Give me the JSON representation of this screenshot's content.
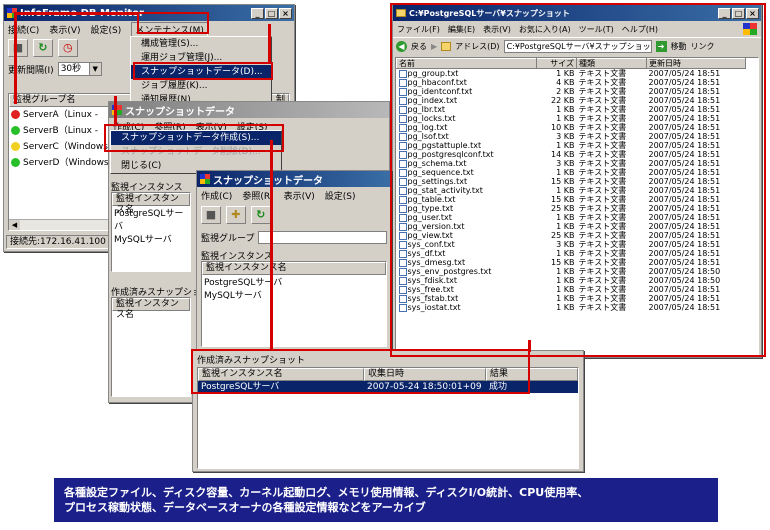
{
  "monitor": {
    "title": "InfoFrame DB Monitor",
    "menu": [
      "接続(C)",
      "表示(V)",
      "設定(S)",
      "メンテナンス(M)"
    ],
    "interval_label": "更新間隔(I)",
    "interval_value": "30秒",
    "group_header": "監視グループ名",
    "col_right": "制",
    "servers": [
      {
        "label": "ServerA（Linux -",
        "status": "error"
      },
      {
        "label": "ServerB（Linux -",
        "status": "ok"
      },
      {
        "label": "ServerC（Windows",
        "status": "warn"
      },
      {
        "label": "ServerD（Windows",
        "status": "ok"
      }
    ],
    "status_bar": "接続先:172.16.41.100",
    "maintenance_menu": [
      "構成管理(S)...",
      "運用ジョブ管理(J)...",
      "スナップショットデータ(D)...",
      "ジョブ履歴(K)...",
      "通知履歴(N)..."
    ]
  },
  "snap1": {
    "title": "スナップショットデータ",
    "menu": [
      "作成(C)",
      "参照(R)",
      "表示(V)",
      "設定(S)"
    ],
    "create_menu": [
      "スナップショットデータ作成(S)...",
      "スナップショットデータ削除(D)...",
      "閉じる(C)"
    ],
    "instance_section": "監視インスタンス",
    "instance_header": "監視インスタンス名",
    "instances": [
      "PostgreSQLサーバ",
      "MySQLサーバ"
    ],
    "created_section": "作成済みスナップショット",
    "created_header": "監視インスタンス名"
  },
  "snap2": {
    "title": "スナップショットデータ",
    "menu": [
      "作成(C)",
      "参照(R)",
      "表示(V)",
      "設定(S)"
    ],
    "group_label": "監視グループ",
    "instance_section": "監視インスタンス",
    "instance_header": "監視インスタンス名",
    "instances": [
      "PostgreSQLサーバ",
      "MySQLサーバ"
    ]
  },
  "snap3": {
    "section": "作成済みスナップショット",
    "headers": [
      "監視インスタンス名",
      "収集日時",
      "結果"
    ],
    "row": [
      "PostgreSQLサーバ",
      "2007-05-24 18:50:01+09",
      "成功"
    ]
  },
  "explorer": {
    "title": "C:¥PostgreSQLサーバ¥スナップショット",
    "menu": [
      "ファイル(F)",
      "編集(E)",
      "表示(V)",
      "お気に入り(A)",
      "ツール(T)",
      "ヘルプ(H)"
    ],
    "back": "戻る",
    "address_label": "アドレス(D)",
    "address": "C:¥PostgreSQLサーバ¥スナップショット",
    "go": "移動",
    "links": "リンク",
    "columns": [
      "名前",
      "サイズ",
      "種類",
      "更新日時"
    ],
    "files": [
      [
        "pg_group.txt",
        "1 KB",
        "テキスト文書",
        "2007/05/24 18:51"
      ],
      [
        "pg_hbaconf.txt",
        "4 KB",
        "テキスト文書",
        "2007/05/24 18:51"
      ],
      [
        "pg_identconf.txt",
        "2 KB",
        "テキスト文書",
        "2007/05/24 18:51"
      ],
      [
        "pg_index.txt",
        "22 KB",
        "テキスト文書",
        "2007/05/24 18:51"
      ],
      [
        "pg_lbr.txt",
        "1 KB",
        "テキスト文書",
        "2007/05/24 18:51"
      ],
      [
        "pg_locks.txt",
        "1 KB",
        "テキスト文書",
        "2007/05/24 18:51"
      ],
      [
        "pg_log.txt",
        "10 KB",
        "テキスト文書",
        "2007/05/24 18:51"
      ],
      [
        "pg_lsof.txt",
        "3 KB",
        "テキスト文書",
        "2007/05/24 18:51"
      ],
      [
        "pg_pgstattuple.txt",
        "1 KB",
        "テキスト文書",
        "2007/05/24 18:51"
      ],
      [
        "pg_postgresqlconf.txt",
        "14 KB",
        "テキスト文書",
        "2007/05/24 18:51"
      ],
      [
        "pg_schema.txt",
        "3 KB",
        "テキスト文書",
        "2007/05/24 18:51"
      ],
      [
        "pg_sequence.txt",
        "1 KB",
        "テキスト文書",
        "2007/05/24 18:51"
      ],
      [
        "pg_settings.txt",
        "15 KB",
        "テキスト文書",
        "2007/05/24 18:51"
      ],
      [
        "pg_stat_activity.txt",
        "1 KB",
        "テキスト文書",
        "2007/05/24 18:51"
      ],
      [
        "pg_table.txt",
        "15 KB",
        "テキスト文書",
        "2007/05/24 18:51"
      ],
      [
        "pg_type.txt",
        "25 KB",
        "テキスト文書",
        "2007/05/24 18:51"
      ],
      [
        "pg_user.txt",
        "1 KB",
        "テキスト文書",
        "2007/05/24 18:51"
      ],
      [
        "pg_version.txt",
        "1 KB",
        "テキスト文書",
        "2007/05/24 18:51"
      ],
      [
        "pg_view.txt",
        "25 KB",
        "テキスト文書",
        "2007/05/24 18:51"
      ],
      [
        "sys_conf.txt",
        "3 KB",
        "テキスト文書",
        "2007/05/24 18:51"
      ],
      [
        "sys_df.txt",
        "1 KB",
        "テキスト文書",
        "2007/05/24 18:51"
      ],
      [
        "sys_dmesg.txt",
        "15 KB",
        "テキスト文書",
        "2007/05/24 18:51"
      ],
      [
        "sys_env_postgres.txt",
        "1 KB",
        "テキスト文書",
        "2007/05/24 18:50"
      ],
      [
        "sys_fdisk.txt",
        "1 KB",
        "テキスト文書",
        "2007/05/24 18:50"
      ],
      [
        "sys_free.txt",
        "1 KB",
        "テキスト文書",
        "2007/05/24 18:51"
      ],
      [
        "sys_fstab.txt",
        "1 KB",
        "テキスト文書",
        "2007/05/24 18:51"
      ],
      [
        "sys_iostat.txt",
        "1 KB",
        "テキスト文書",
        "2007/05/24 18:51"
      ]
    ]
  },
  "caption": {
    "line1": "各種設定ファイル、ディスク容量、カーネル起動ログ、メモリ使用情報、ディスクI/O統計、CPU使用率、",
    "line2": "プロセス稼動状態、データベースオーナの各種設定情報などをアーカイブ"
  },
  "colors": {
    "accent_red": "#d40000",
    "title_blue": "#0a246a",
    "banner": "#1b1f8a"
  }
}
